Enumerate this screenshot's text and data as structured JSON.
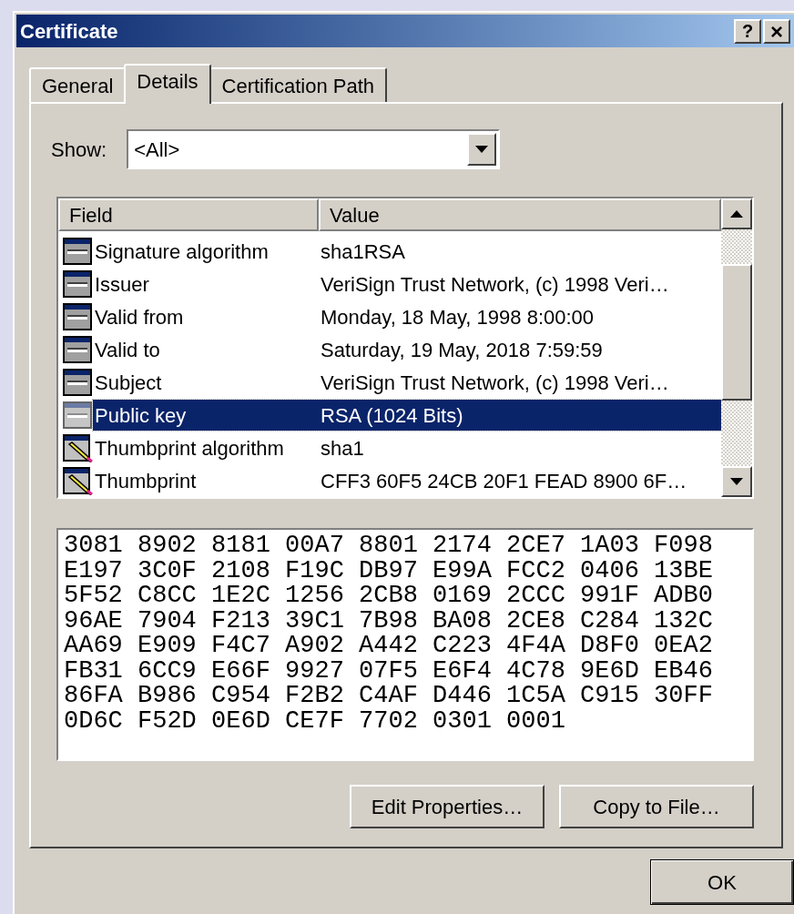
{
  "window": {
    "title": "Certificate",
    "help_button": "?",
    "close_button": "×"
  },
  "tabs": [
    {
      "label": "General",
      "selected": false
    },
    {
      "label": "Details",
      "selected": true
    },
    {
      "label": "Certification Path",
      "selected": false
    }
  ],
  "show": {
    "label": "Show:",
    "value": "<All>"
  },
  "table": {
    "columns": [
      "Field",
      "Value"
    ],
    "rows": [
      {
        "kind": "field",
        "field": "Signature algorithm",
        "value": "sha1RSA",
        "selected": false
      },
      {
        "kind": "field",
        "field": "Issuer",
        "value": "VeriSign Trust Network, (c) 1998 Veri…",
        "selected": false
      },
      {
        "kind": "field",
        "field": "Valid from",
        "value": "Monday, 18 May, 1998 8:00:00",
        "selected": false
      },
      {
        "kind": "field",
        "field": "Valid to",
        "value": "Saturday, 19 May, 2018 7:59:59",
        "selected": false
      },
      {
        "kind": "field",
        "field": "Subject",
        "value": "VeriSign Trust Network, (c) 1998 Veri…",
        "selected": false
      },
      {
        "kind": "field",
        "field": "Public key",
        "value": "RSA (1024 Bits)",
        "selected": true
      },
      {
        "kind": "property",
        "field": "Thumbprint algorithm",
        "value": "sha1",
        "selected": false
      },
      {
        "kind": "property",
        "field": "Thumbprint",
        "value": "CFF3 60F5 24CB 20F1 FEAD 8900 6F…",
        "selected": false
      }
    ]
  },
  "detail_lines": [
    "3081 8902 8181 00A7 8801 2174 2CE7 1A03 F098",
    "E197 3C0F 2108 F19C DB97 E99A FCC2 0406 13BE",
    "5F52 C8CC 1E2C 1256 2CB8 0169 2CCC 991F ADB0",
    "96AE 7904 F213 39C1 7B98 BA08 2CE8 C284 132C",
    "AA69 E909 F4C7 A902 A442 C223 4F4A D8F0 0EA2",
    "FB31 6CC9 E66F 9927 07F5 E6F4 4C78 9E6D EB46",
    "86FA B986 C954 F2B2 C4AF D446 1C5A C915 30FF",
    "0D6C F52D 0E6D CE7F 7702 0301 0001"
  ],
  "buttons": [
    "Edit Properties…",
    "Copy to File…"
  ],
  "ok_button": "OK"
}
